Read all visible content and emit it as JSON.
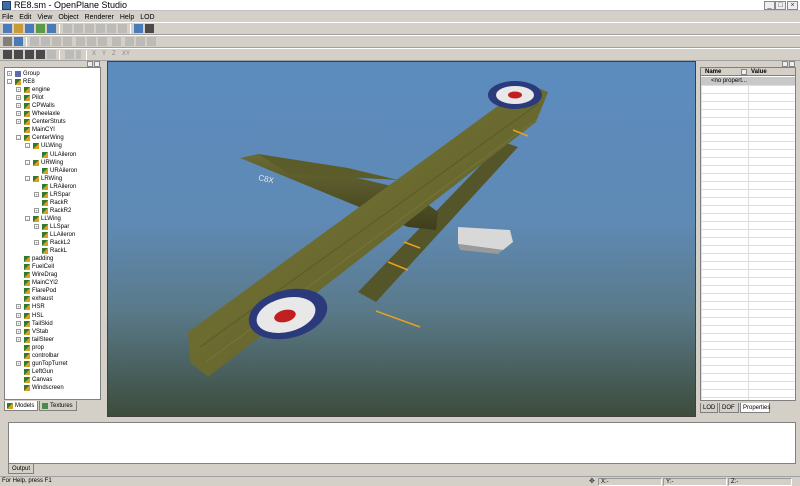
{
  "window": {
    "title": "RE8.sm - OpenPlane Studio"
  },
  "menu": [
    "File",
    "Edit",
    "View",
    "Object",
    "Renderer",
    "Help",
    "LOD"
  ],
  "toolbar3_text": {
    "x": "X",
    "y": "Y",
    "z": "Z",
    "xy": "XY"
  },
  "tree": [
    {
      "label": "Group",
      "depth": 0,
      "expand": "+",
      "icon": "grp"
    },
    {
      "label": "RE8",
      "depth": 0,
      "expand": "-",
      "icon": "node"
    },
    {
      "label": "engine",
      "depth": 1,
      "expand": "+",
      "icon": "node"
    },
    {
      "label": "Pilot",
      "depth": 1,
      "expand": "+",
      "icon": "node"
    },
    {
      "label": "CPWalls",
      "depth": 1,
      "expand": "+",
      "icon": "node"
    },
    {
      "label": "Wheelaxle",
      "depth": 1,
      "expand": "+",
      "icon": "node"
    },
    {
      "label": "CenterStruts",
      "depth": 1,
      "expand": "+",
      "icon": "node"
    },
    {
      "label": "MainCYl",
      "depth": 1,
      "expand": "",
      "icon": "node"
    },
    {
      "label": "CenterWing",
      "depth": 1,
      "expand": "-",
      "icon": "node"
    },
    {
      "label": "ULWing",
      "depth": 2,
      "expand": "-",
      "icon": "node"
    },
    {
      "label": "ULAileron",
      "depth": 3,
      "expand": "",
      "icon": "node"
    },
    {
      "label": "URWing",
      "depth": 2,
      "expand": "-",
      "icon": "node"
    },
    {
      "label": "URAileron",
      "depth": 3,
      "expand": "",
      "icon": "node"
    },
    {
      "label": "LRWing",
      "depth": 2,
      "expand": "-",
      "icon": "node"
    },
    {
      "label": "LRAileron",
      "depth": 3,
      "expand": "",
      "icon": "node"
    },
    {
      "label": "LRSpar",
      "depth": 3,
      "expand": "+",
      "icon": "node"
    },
    {
      "label": "RackR",
      "depth": 3,
      "expand": "",
      "icon": "node"
    },
    {
      "label": "RackR2",
      "depth": 3,
      "expand": "+",
      "icon": "node"
    },
    {
      "label": "LLWing",
      "depth": 2,
      "expand": "-",
      "icon": "node"
    },
    {
      "label": "LLSpar",
      "depth": 3,
      "expand": "+",
      "icon": "node"
    },
    {
      "label": "LLAileron",
      "depth": 3,
      "expand": "",
      "icon": "node"
    },
    {
      "label": "RackL2",
      "depth": 3,
      "expand": "+",
      "icon": "node"
    },
    {
      "label": "RackL",
      "depth": 3,
      "expand": "",
      "icon": "node"
    },
    {
      "label": "padding",
      "depth": 1,
      "expand": "",
      "icon": "node"
    },
    {
      "label": "FuelCell",
      "depth": 1,
      "expand": "",
      "icon": "node"
    },
    {
      "label": "WireDrag",
      "depth": 1,
      "expand": "",
      "icon": "node"
    },
    {
      "label": "MainCYl2",
      "depth": 1,
      "expand": "",
      "icon": "node"
    },
    {
      "label": "FlarePod",
      "depth": 1,
      "expand": "",
      "icon": "node"
    },
    {
      "label": "exhaust",
      "depth": 1,
      "expand": "",
      "icon": "node"
    },
    {
      "label": "HSR",
      "depth": 1,
      "expand": "+",
      "icon": "node"
    },
    {
      "label": "HSL",
      "depth": 1,
      "expand": "+",
      "icon": "node"
    },
    {
      "label": "TailSkid",
      "depth": 1,
      "expand": "+",
      "icon": "node"
    },
    {
      "label": "VStab",
      "depth": 1,
      "expand": "+",
      "icon": "node"
    },
    {
      "label": "tailSteer",
      "depth": 1,
      "expand": "+",
      "icon": "node"
    },
    {
      "label": "prop",
      "depth": 1,
      "expand": "",
      "icon": "node"
    },
    {
      "label": "controlbar",
      "depth": 1,
      "expand": "",
      "icon": "node"
    },
    {
      "label": "gunTopTurret",
      "depth": 1,
      "expand": "+",
      "icon": "node"
    },
    {
      "label": "LeftGun",
      "depth": 1,
      "expand": "",
      "icon": "node"
    },
    {
      "label": "Canvas",
      "depth": 1,
      "expand": "",
      "icon": "node"
    },
    {
      "label": "Windscreen",
      "depth": 1,
      "expand": "",
      "icon": "node"
    }
  ],
  "left_tabs": {
    "models": "Models",
    "textures": "Textures"
  },
  "properties": {
    "col_name": "Name",
    "col_value": "Value",
    "empty_row": "<no propert..."
  },
  "right_tabs": {
    "lod": "LOD",
    "dof": "DOF",
    "properties": "Properties"
  },
  "model": {
    "fuselage_serial": "C8X"
  },
  "output_tab": "Output",
  "status": {
    "message": "For Help, press F1",
    "x_label": "X:-",
    "y_label": "Y:-",
    "z_label": "Z:-"
  },
  "colors": {
    "sky_top": "#5c8bbf",
    "ground": "#3d4c3c",
    "wing": "#6a6a30",
    "roundel_outer": "#2a3a7a",
    "roundel_mid": "#e8e8e8",
    "roundel_center": "#c02020",
    "marker": "#e8a020"
  }
}
